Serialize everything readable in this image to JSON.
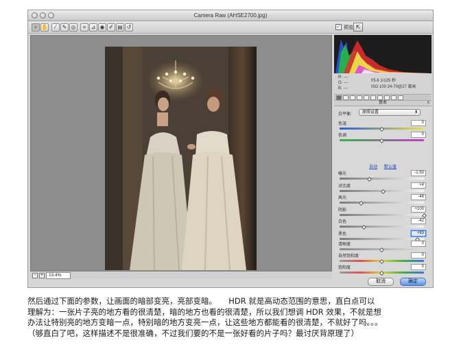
{
  "window": {
    "title": "Camera Raw (AHSE2700.jpg)"
  },
  "toolbar": {
    "tools": [
      {
        "icon": "zoom-tool-icon",
        "glyph": "⌕"
      },
      {
        "icon": "hand-tool-icon",
        "glyph": "✋"
      },
      {
        "icon": "white-balance-tool-icon",
        "glyph": "⁄"
      },
      {
        "icon": "color-sampler-tool-icon",
        "glyph": "✎"
      },
      {
        "icon": "targeted-adjustment-tool-icon",
        "glyph": "◎"
      },
      {
        "icon": "crop-tool-icon",
        "glyph": "⌗"
      },
      {
        "icon": "straighten-tool-icon",
        "glyph": "⊿"
      },
      {
        "icon": "red-eye-tool-icon",
        "glyph": "◉"
      },
      {
        "icon": "adjustment-brush-icon",
        "glyph": "✐"
      },
      {
        "icon": "graduated-filter-icon",
        "glyph": "▤"
      },
      {
        "icon": "rotate-tool-icon",
        "glyph": "↺"
      }
    ],
    "preview_label": "预览",
    "preview_checked": "✓",
    "fullscreen_glyph": "⇱"
  },
  "zoom": {
    "minus": "-",
    "plus": "+",
    "value": "13.4%"
  },
  "info": {
    "r_label": "R:",
    "g_label": "G:",
    "b_label": "B:",
    "r_val": "---",
    "g_val": "---",
    "b_val": "---",
    "aperture_shutter": "f/5.6   1/125 秒",
    "iso_lens": "ISO 100   24-70@27 毫米"
  },
  "panel": {
    "section_title": "基本",
    "section_menu_glyph": "≡",
    "white_balance_label": "白平衡:",
    "white_balance_value": "原照设置",
    "white_balance_arrow": "⬍",
    "sliders_wb": [
      {
        "label": "色温",
        "value": "0",
        "pos": 0.5,
        "gradient": "linear-gradient(to right,#2a5bd7,#f1e04a)"
      },
      {
        "label": "色调",
        "value": "0",
        "pos": 0.5,
        "gradient": "linear-gradient(to right,#33b34a,#c63bc6)"
      }
    ],
    "auto_label": "自动",
    "default_label": "默认值",
    "sliders_tone": [
      {
        "label": "曝光",
        "value": "-1.50",
        "pos": 0.35
      },
      {
        "label": "对比度",
        "value": "+4",
        "pos": 0.52
      },
      {
        "label": "高光",
        "value": "-48",
        "pos": 0.26
      },
      {
        "label": "阴影",
        "value": "+100",
        "pos": 1.0
      },
      {
        "label": "白色",
        "value": "-42",
        "pos": 0.29
      },
      {
        "label": "黑色",
        "value": "+83",
        "pos": 0.92,
        "focus": true
      }
    ],
    "sliders_presence": [
      {
        "label": "清晰度",
        "value": "0",
        "pos": 0.5,
        "gradient": "linear-gradient(to right,#8a8a8a,#e0e0e0)"
      },
      {
        "label": "自然饱和度",
        "value": "0",
        "pos": 0.5,
        "gradient": "linear-gradient(to right,#9a9a9a,#e05050,#e0d040,#40b040,#4070e0)"
      },
      {
        "label": "饱和度",
        "value": "0",
        "pos": 0.5,
        "gradient": "linear-gradient(to right,#9a9a9a,#e05050,#e0d040,#40b040,#4070e0)"
      }
    ]
  },
  "buttons": {
    "cancel": "取消",
    "ok": "确定"
  },
  "article": {
    "lines": [
      "然后通过下面的参数，让画面的暗部变亮，亮部变暗。　　HDR 就是高动态范围的意思，直白点可以",
      "理解为：一张片子亮的地方看的很清楚，暗的地方也看的很清楚，所以我们想调 HDR 效果，不就是想",
      "办法让特别亮的地方变暗一点，特别暗的地方变亮一点，让这些地方都能看的很清楚，不就好了吗。。。",
      "（够直白了吧，这样描述不是很准确，不过我们要的不是一张好看的片子吗？最讨厌背原理了）"
    ]
  }
}
